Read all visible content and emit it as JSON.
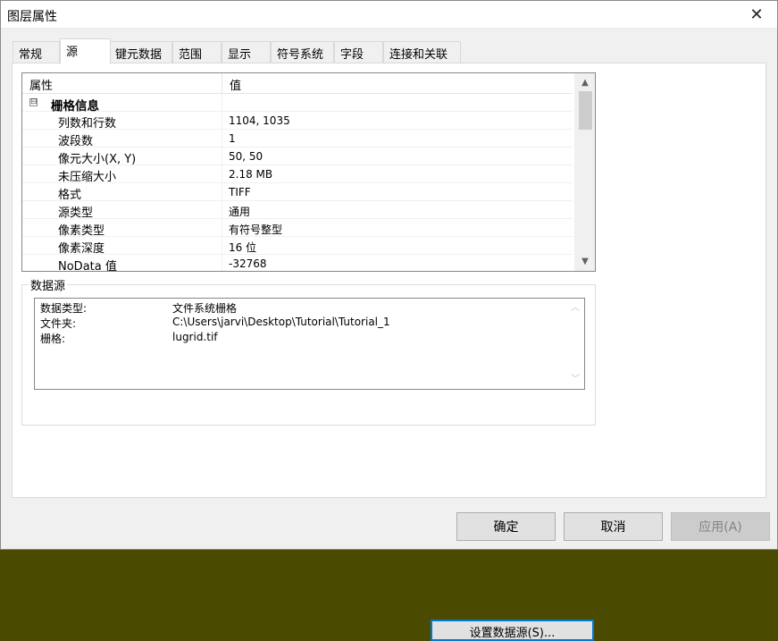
{
  "window": {
    "title": "图层属性",
    "close_glyph": "✕"
  },
  "tabs": [
    "常规",
    "源",
    "键元数据",
    "范围",
    "显示",
    "符号系统",
    "字段",
    "连接和关联"
  ],
  "active_tab": "源",
  "grid": {
    "col_property": "属性",
    "col_value": "值",
    "group": {
      "label": "栅格信息",
      "expander": "⊟"
    },
    "rows": [
      {
        "k": "列数和行数",
        "v": "1104, 1035"
      },
      {
        "k": "波段数",
        "v": "1"
      },
      {
        "k": "像元大小(X, Y)",
        "v": "50, 50"
      },
      {
        "k": "未压缩大小",
        "v": "2.18 MB"
      },
      {
        "k": "格式",
        "v": "TIFF"
      },
      {
        "k": "源类型",
        "v": "通用"
      },
      {
        "k": "像素类型",
        "v": "有符号整型"
      },
      {
        "k": "像素深度",
        "v": "16 位"
      },
      {
        "k": "NoData 值",
        "v": "-32768"
      }
    ],
    "scroll_up": "▲",
    "scroll_down": "▼"
  },
  "datasource": {
    "label": "数据源",
    "rows": [
      {
        "k": "数据类型:",
        "v": "文件系统栅格"
      },
      {
        "k": "文件夹:",
        "v": "C:\\Users\\jarvi\\Desktop\\Tutorial\\Tutorial_1"
      },
      {
        "k": "栅格:",
        "v": "lugrid.tif"
      }
    ],
    "scroll_up": "︿",
    "scroll_down": "﹀",
    "set_button": "设置数据源(S)..."
  },
  "buttons": {
    "ok": "确定",
    "cancel": "取消",
    "apply": "应用(A)"
  }
}
